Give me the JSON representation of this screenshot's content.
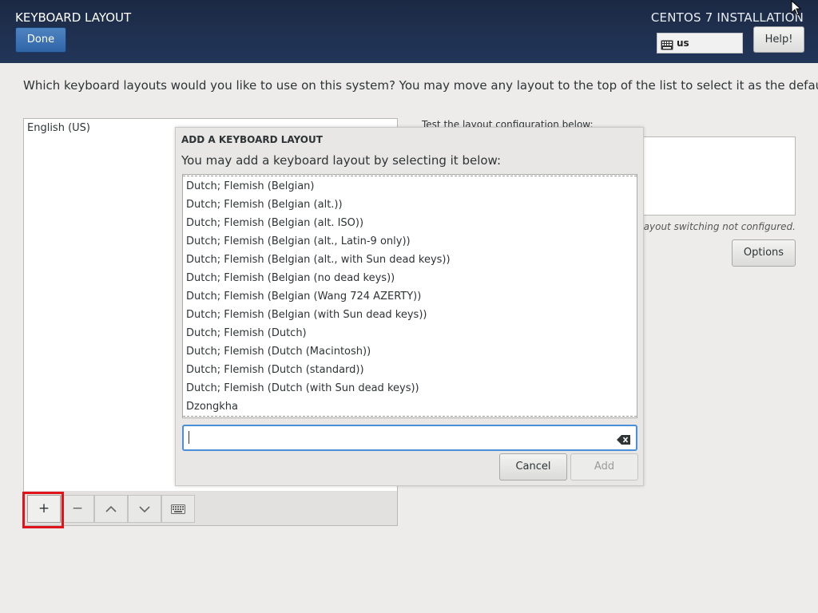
{
  "header": {
    "title": "KEYBOARD LAYOUT",
    "done_label": "Done",
    "install_title": "CENTOS 7 INSTALLATION",
    "kb_indicator": "us",
    "help_label": "Help!"
  },
  "instructions": "Which keyboard layouts would you like to use on this system?  You may move any layout to the top of the list to select it as the default.",
  "layouts": [
    "English (US)"
  ],
  "toolbar": {
    "add_label": "+",
    "remove_label": "−",
    "up_icon": "chevron-up-icon",
    "down_icon": "chevron-down-icon",
    "preview_icon": "keyboard-icon"
  },
  "test": {
    "label": "Test the layout configuration below:",
    "switch_note": "Layout switching not configured.",
    "options_label": "Options"
  },
  "dialog": {
    "title": "ADD A KEYBOARD LAYOUT",
    "subtitle": "You may add a keyboard layout by selecting it below:",
    "items": [
      "Dutch; Flemish (Belgian)",
      "Dutch; Flemish (Belgian (alt.))",
      "Dutch; Flemish (Belgian (alt. ISO))",
      "Dutch; Flemish (Belgian (alt., Latin-9 only))",
      "Dutch; Flemish (Belgian (alt., with Sun dead keys))",
      "Dutch; Flemish (Belgian (no dead keys))",
      "Dutch; Flemish (Belgian (Wang 724 AZERTY))",
      "Dutch; Flemish (Belgian (with Sun dead keys))",
      "Dutch; Flemish (Dutch)",
      "Dutch; Flemish (Dutch (Macintosh))",
      "Dutch; Flemish (Dutch (standard))",
      "Dutch; Flemish (Dutch (with Sun dead keys))",
      "Dzongkha"
    ],
    "search_value": "",
    "cancel_label": "Cancel",
    "add_label": "Add"
  },
  "colors": {
    "header_bg": "#1b2943",
    "accent": "#4a90d9",
    "done_button": "#3a70b5",
    "highlight": "#e0141c"
  }
}
